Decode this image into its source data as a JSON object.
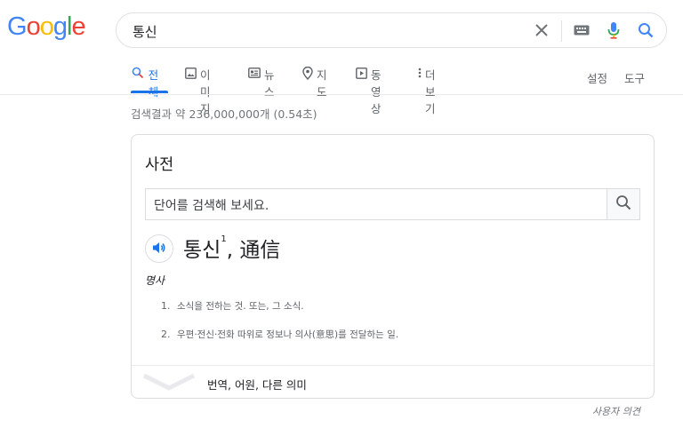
{
  "logo": {
    "letters": [
      "G",
      "o",
      "o",
      "g",
      "l",
      "e"
    ],
    "colors": [
      "#4285F4",
      "#EA4335",
      "#FBBC05",
      "#4285F4",
      "#34A853",
      "#EA4335"
    ]
  },
  "search": {
    "query": "통신"
  },
  "icons": {
    "clear": "close-icon",
    "keyboard": "keyboard-icon",
    "mic": "mic-icon",
    "search": "search-icon"
  },
  "tabs": [
    {
      "label": "전체",
      "icon": "search-icon"
    },
    {
      "label": "이미지",
      "icon": "image-icon"
    },
    {
      "label": "뉴스",
      "icon": "news-icon"
    },
    {
      "label": "지도",
      "icon": "map-pin-icon"
    },
    {
      "label": "동영상",
      "icon": "video-icon"
    },
    {
      "label": "더보기",
      "icon": "more-vert-icon"
    }
  ],
  "tools": {
    "settings": "설정",
    "tools": "도구"
  },
  "stats": "검색결과 약 236,000,000개 (0.54초)",
  "dictionary": {
    "title": "사전",
    "input_placeholder": "단어를 검색해 보세요.",
    "word": "통신",
    "superscript": "1",
    "hanja": ", 通信",
    "pos": "명사",
    "definitions": [
      {
        "num": "1.",
        "text": "소식을 전하는 것. 또는, 그 소식."
      },
      {
        "num": "2.",
        "text": "우편·전신·전화 따위로 정보나 의사(意思)를 전달하는 일."
      }
    ],
    "more": "번역, 어원, 다른 의미"
  },
  "feedback": "사용자 의견",
  "colors": {
    "accent": "#1a73e8",
    "mic_blue": "#4285F4",
    "mic_red": "#EA4335"
  }
}
